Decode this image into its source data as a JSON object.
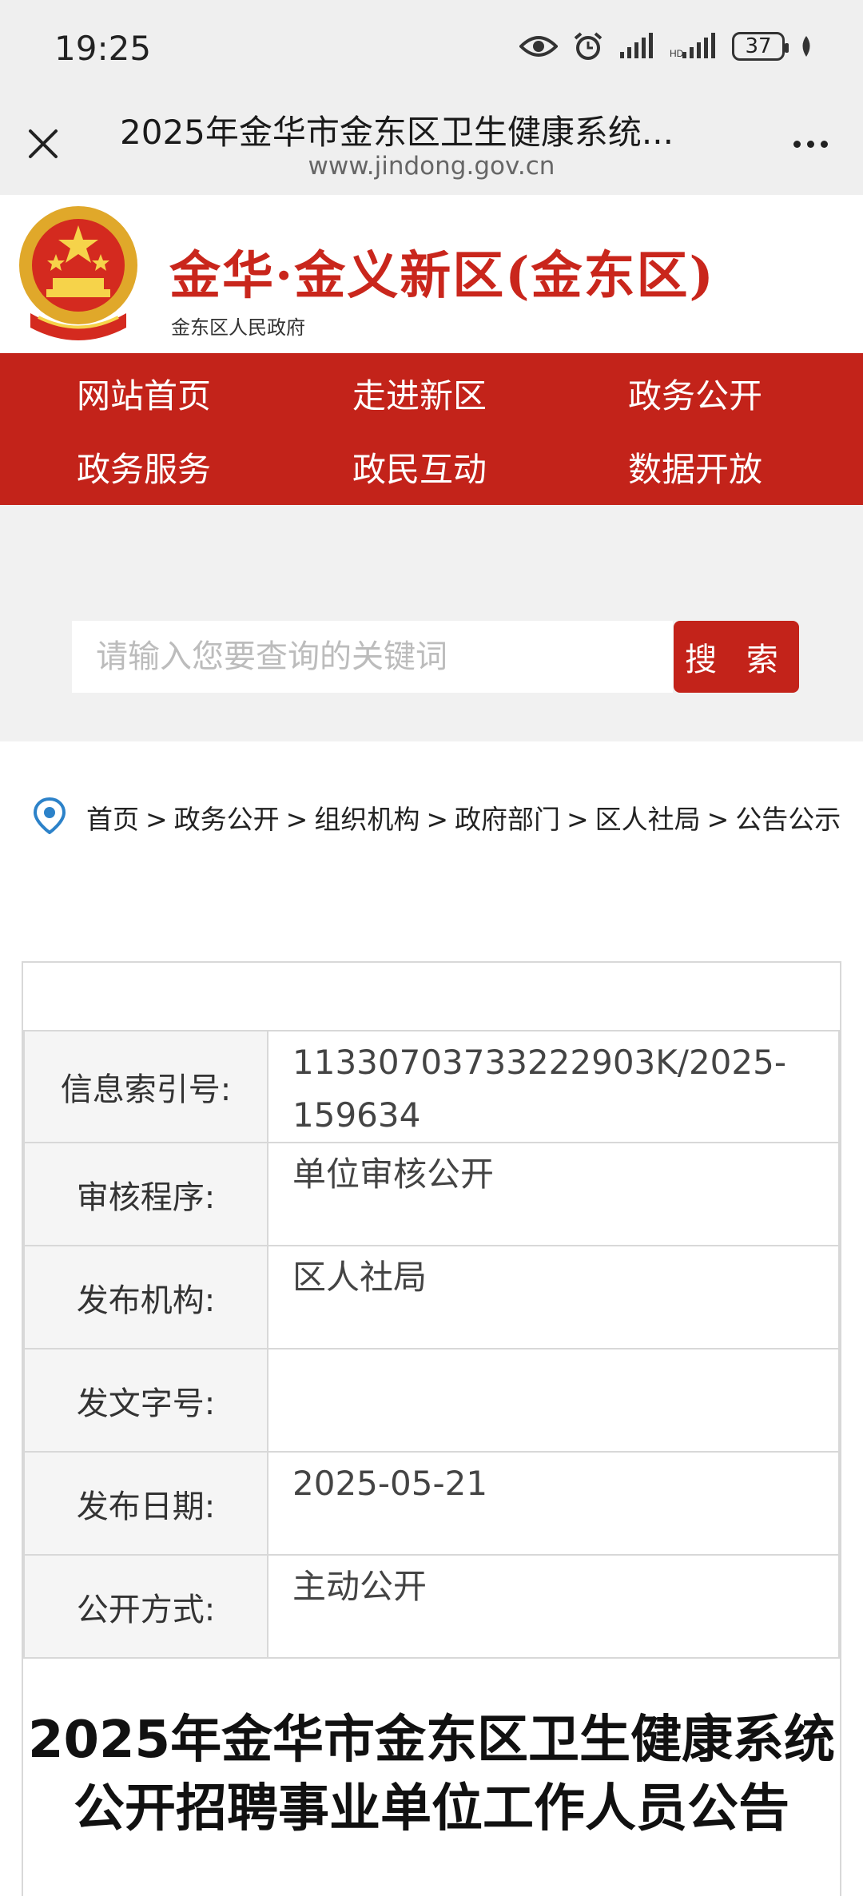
{
  "status_bar": {
    "time": "19:25",
    "battery": "37"
  },
  "browser": {
    "title": "2025年金华市金东区卫生健康系统...",
    "url": "www.jindong.gov.cn"
  },
  "site": {
    "brand_title": "金华·金义新区(金东区)",
    "brand_subtitle": "金东区人民政府"
  },
  "nav": {
    "items": [
      {
        "label": "网站首页"
      },
      {
        "label": "走进新区"
      },
      {
        "label": "政务公开"
      },
      {
        "label": "政务服务"
      },
      {
        "label": "政民互动"
      },
      {
        "label": "数据开放"
      }
    ]
  },
  "search": {
    "placeholder": "请输入您要查询的关键词",
    "button_label": "搜 索"
  },
  "breadcrumb": {
    "items": [
      "首页",
      "政务公开",
      "组织机构",
      "政府部门",
      "区人社局",
      "公告公示"
    ],
    "separator": ">"
  },
  "info": {
    "rows": [
      {
        "label": "信息索引号:",
        "value": "11330703733222903K/2025-159634"
      },
      {
        "label": "审核程序:",
        "value": "单位审核公开"
      },
      {
        "label": "发布机构:",
        "value": "区人社局"
      },
      {
        "label": "发文字号:",
        "value": ""
      },
      {
        "label": "发布日期:",
        "value": "2025-05-21"
      },
      {
        "label": "公开方式:",
        "value": "主动公开"
      }
    ]
  },
  "article": {
    "title": "2025年金华市金东区卫生健康系统公开招聘事业单位工作人员公告"
  },
  "colors": {
    "brand_red": "#c3231a",
    "page_gray": "#efefef"
  }
}
